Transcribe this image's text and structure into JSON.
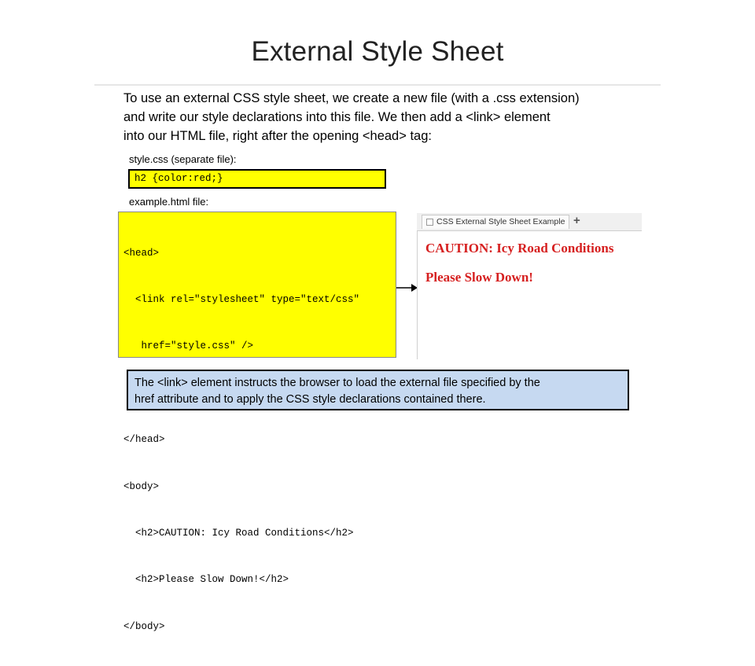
{
  "slide": {
    "title": "External Style Sheet",
    "intro_lines": [
      "To use an external CSS style sheet, we create a new file (with a .css extension)",
      "and write our style declarations into this file. We then add a <link> element",
      "into our HTML file, right after the opening <head> tag:"
    ],
    "css_label": "style.css (separate file):",
    "css_code": "h2 {color:red;}",
    "html_label": "example.html file:",
    "html_code": [
      "<head>",
      "  <link rel=\"stylesheet\" type=\"text/css\"",
      "   href=\"style.css\" />",
      "  ...",
      "</head>",
      "<body>",
      "  <h2>CAUTION: Icy Road Conditions</h2>",
      "  <h2>Please Slow Down!</h2>",
      "</body>"
    ],
    "browser": {
      "tab_title": "CSS External Style Sheet Example",
      "new_tab_symbol": "+",
      "heading_1": "CAUTION: Icy Road Conditions",
      "heading_2": "Please Slow Down!",
      "heading_color": "#d62020"
    },
    "note_lines": [
      "The <link> element instructs the browser to load the external file specified by the",
      "href attribute and to apply the CSS style declarations contained there."
    ],
    "colors": {
      "code_background": "#ffff00",
      "note_background": "#c6d9f1"
    }
  }
}
